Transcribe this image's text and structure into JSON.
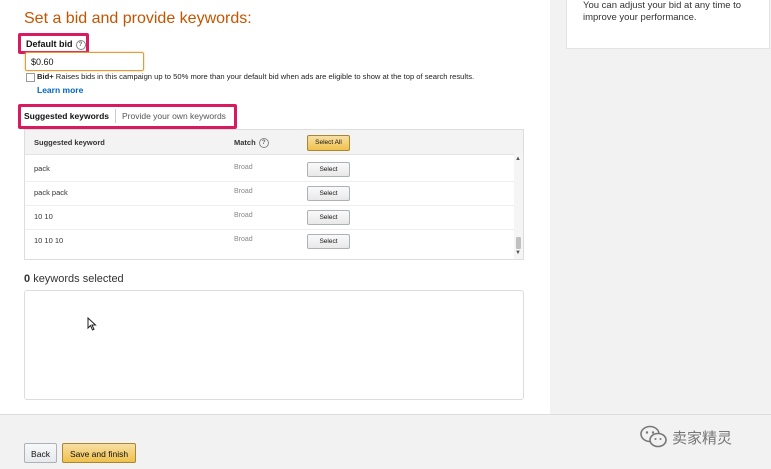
{
  "side_tip": "You can adjust your bid at any time to improve your performance.",
  "section_title": "Set a bid and provide keywords:",
  "default_bid": {
    "label": "Default bid",
    "help_icon": "?",
    "value": "$0.60"
  },
  "bid_plus": {
    "label": "Bid+",
    "description": "Raises bids in this campaign up to 50% more than your default bid when ads are eligible to show at the top of search results.",
    "learn_more": "Learn more"
  },
  "tabs": {
    "suggested": "Suggested keywords",
    "own": "Provide your own keywords"
  },
  "table": {
    "col_keyword": "Suggested keyword",
    "col_match": "Match",
    "match_help_icon": "?",
    "select_all": "Select All",
    "rows": [
      {
        "keyword": "pack",
        "match": "Broad",
        "action": "Select"
      },
      {
        "keyword": "pack pack",
        "match": "Broad",
        "action": "Select"
      },
      {
        "keyword": "10 10",
        "match": "Broad",
        "action": "Select"
      },
      {
        "keyword": "10 10 10",
        "match": "Broad",
        "action": "Select"
      }
    ]
  },
  "selected": {
    "count": "0",
    "label": "keywords selected"
  },
  "footer": {
    "back": "Back",
    "save": "Save and finish"
  },
  "watermark": {
    "text": "卖家精灵",
    "icon": "wechat-icon"
  },
  "colors": {
    "section_title": "#c45500",
    "highlight": "#d81b60",
    "link": "#0066c0",
    "primary_button": "#f0c14b"
  }
}
